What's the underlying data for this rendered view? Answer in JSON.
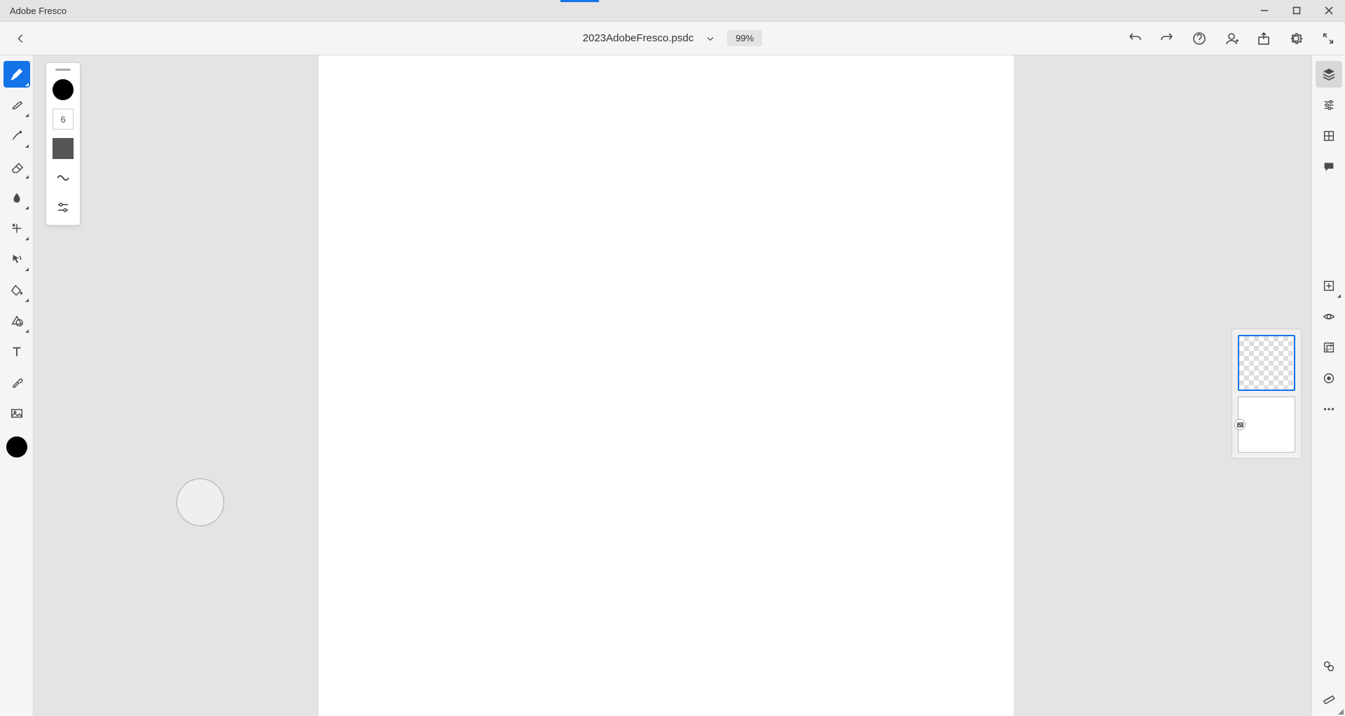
{
  "app": {
    "title": "Adobe Fresco"
  },
  "document": {
    "filename": "2023AdobeFresco.psdc",
    "zoom": "99%"
  },
  "brush": {
    "size": "6",
    "color": "#000000"
  },
  "colors": {
    "accent": "#1473e6",
    "current": "#000000"
  }
}
